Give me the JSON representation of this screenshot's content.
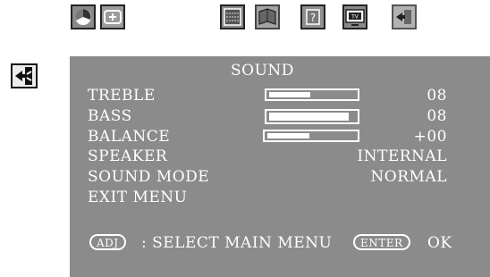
{
  "top_icons": [
    {
      "name": "sound-icon"
    },
    {
      "name": "screen-adjust-icon"
    },
    {
      "name": "calendar-icon"
    },
    {
      "name": "book-icon"
    },
    {
      "name": "help-icon",
      "glyph": "?"
    },
    {
      "name": "tv-icon",
      "glyph": "TV"
    },
    {
      "name": "exit-door-icon"
    }
  ],
  "menu": {
    "title": "SOUND",
    "rows": [
      {
        "label": "TREBLE",
        "value": "08",
        "level": 0.5
      },
      {
        "label": "BASS",
        "value": "08",
        "level": 0.97
      },
      {
        "label": "BALANCE",
        "value": "+00",
        "level": 0.5
      },
      {
        "label": "SPEAKER",
        "value": "INTERNAL"
      },
      {
        "label": "SOUND MODE",
        "value": "NORMAL"
      },
      {
        "label": "EXIT MENU",
        "value": ""
      }
    ]
  },
  "footer": {
    "adj_key": "ADJ",
    "adj_text": ": SELECT MAIN MENU",
    "enter_key": "ENTER",
    "enter_text": "OK"
  },
  "colors": {
    "panel_bg": "#8b8b8b",
    "text": "#ffffff"
  }
}
